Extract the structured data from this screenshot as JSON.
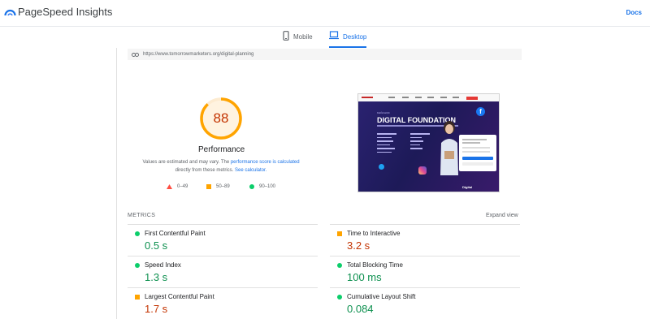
{
  "app": {
    "title": "PageSpeed Insights",
    "docs_label": "Docs",
    "accent": "#1a73e8"
  },
  "tabs": [
    {
      "label": "Mobile",
      "icon": "mobile-phone-icon",
      "active": false
    },
    {
      "label": "Desktop",
      "icon": "desktop-laptop-icon",
      "active": true
    }
  ],
  "report": {
    "url": "https://www.tomorrowmarketers.org/digital-planning",
    "score": "88",
    "score_color": "#ffa400",
    "category": "Performance",
    "desc_prefix": "Values are estimated and may vary. The",
    "desc_link1": "performance score is calculated",
    "desc_middle": "directly from these metrics.",
    "desc_link2": "See calculator.",
    "legend": [
      {
        "range": "0–49",
        "icon": "triangle-fail-icon",
        "color": "#ff4e42"
      },
      {
        "range": "50–89",
        "icon": "square-average-icon",
        "color": "#ffa400"
      },
      {
        "range": "90–100",
        "icon": "circle-pass-icon",
        "color": "#0cce6b"
      }
    ]
  },
  "thumbnail": {
    "kicker": "KHÓA HỌC",
    "heading": "DIGITAL FOUNDATION",
    "footer": "Digital"
  },
  "metrics": {
    "header": "METRICS",
    "expand_label": "Expand view",
    "items": [
      {
        "name": "First Contentful Paint",
        "value": "0.5 s",
        "status": "pass"
      },
      {
        "name": "Time to Interactive",
        "value": "3.2 s",
        "status": "average"
      },
      {
        "name": "Speed Index",
        "value": "1.3 s",
        "status": "pass"
      },
      {
        "name": "Total Blocking Time",
        "value": "100 ms",
        "status": "pass"
      },
      {
        "name": "Largest Contentful Paint",
        "value": "1.7 s",
        "status": "average"
      },
      {
        "name": "Cumulative Layout Shift",
        "value": "0.084",
        "status": "pass"
      }
    ]
  }
}
